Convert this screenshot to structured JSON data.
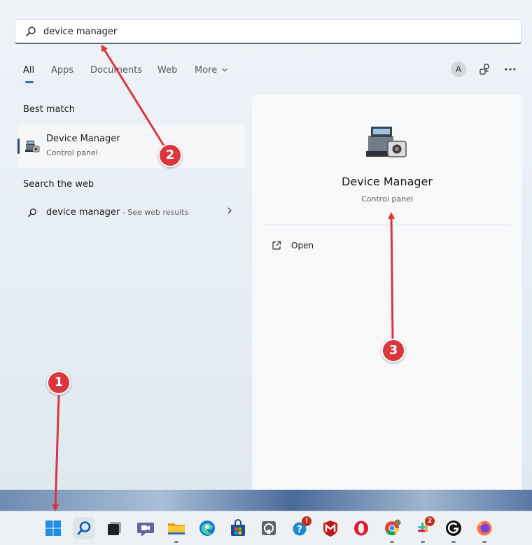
{
  "search": {
    "value": "device manager"
  },
  "tabs": [
    {
      "label": "All",
      "active": true
    },
    {
      "label": "Apps"
    },
    {
      "label": "Documents"
    },
    {
      "label": "Web"
    },
    {
      "label": "More"
    }
  ],
  "header_actions": {
    "avatar_letter": "A"
  },
  "results": {
    "best_match_label": "Best match",
    "best_match": {
      "title": "Device Manager",
      "subtitle": "Control panel",
      "icon": "device-manager-icon"
    },
    "web_label": "Search the web",
    "web_result": {
      "query": "device manager",
      "suffix": " - See web results"
    }
  },
  "detail": {
    "title": "Device Manager",
    "subtitle": "Control panel",
    "actions": [
      {
        "label": "Open",
        "icon": "open-external-icon"
      }
    ]
  },
  "taskbar": {
    "apps": [
      {
        "name": "start",
        "icon": "windows-start-icon"
      },
      {
        "name": "search",
        "icon": "search-icon",
        "active": true
      },
      {
        "name": "task-view",
        "icon": "task-view-icon"
      },
      {
        "name": "teams",
        "icon": "teams-chat-icon"
      },
      {
        "name": "file-explorer",
        "icon": "folder-icon",
        "running": true
      },
      {
        "name": "edge",
        "icon": "edge-icon"
      },
      {
        "name": "store",
        "icon": "store-icon"
      },
      {
        "name": "app-8",
        "icon": "robot-app-icon"
      },
      {
        "name": "app-9",
        "icon": "shield-question-icon",
        "badge": "!"
      },
      {
        "name": "mcafee",
        "icon": "mcafee-icon"
      },
      {
        "name": "opera",
        "icon": "opera-icon"
      },
      {
        "name": "chrome",
        "icon": "chrome-icon",
        "running": true
      },
      {
        "name": "slack",
        "icon": "slack-icon",
        "badge": "2",
        "running": true
      },
      {
        "name": "logitech",
        "icon": "logitech-g-icon",
        "running": true
      },
      {
        "name": "firefox",
        "icon": "firefox-icon",
        "running": true
      }
    ]
  },
  "callouts": [
    {
      "number": "1",
      "target": "start-button"
    },
    {
      "number": "2",
      "target": "search-input"
    },
    {
      "number": "3",
      "target": "detail-app-title"
    }
  ],
  "colors": {
    "accent": "#2f6fb5",
    "callout": "#d9363e",
    "badge": "#c42b1c"
  }
}
